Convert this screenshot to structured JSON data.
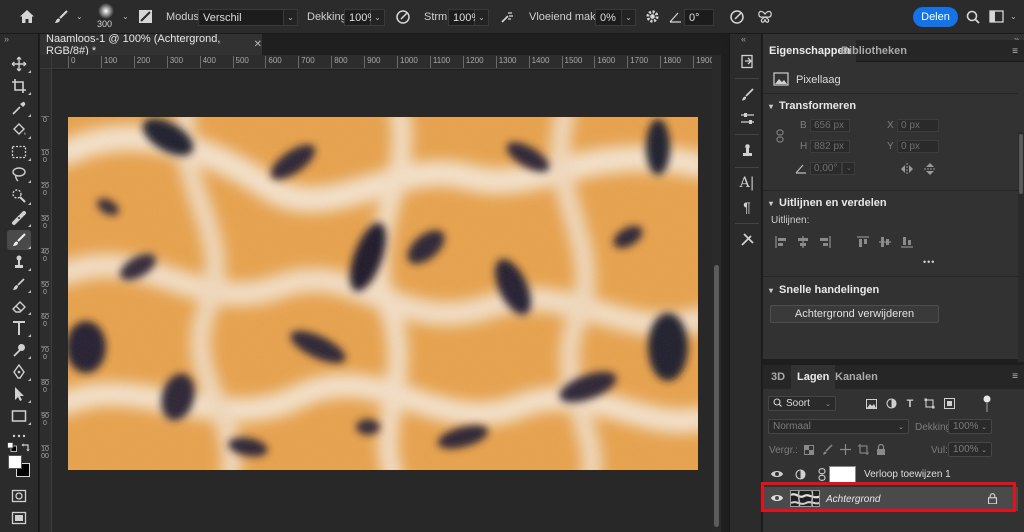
{
  "options_bar": {
    "brush_size": "300",
    "modus_label": "Modus:",
    "modus_value": "Verschil",
    "dekking_label": "Dekking:",
    "dekking_value": "100%",
    "strm_label": "Strm:",
    "strm_value": "100%",
    "vloeiend_label": "Vloeiend maken:",
    "vloeiend_value": "0%",
    "angle_value": "0°",
    "share_label": "Delen"
  },
  "document": {
    "tab_title": "Naamloos-1 @ 100% (Achtergrond, RGB/8#) *",
    "ruler_h": [
      "0",
      "100",
      "200",
      "300",
      "400",
      "500",
      "600",
      "700",
      "800",
      "900",
      "1000",
      "1100",
      "1200",
      "1300",
      "1400",
      "1500",
      "1600",
      "1700",
      "1800",
      "1900"
    ],
    "ruler_v": [
      "0",
      "100",
      "200",
      "300",
      "400",
      "500",
      "600",
      "700",
      "800",
      "900",
      "1000"
    ]
  },
  "properties": {
    "tabs": [
      "Eigenschappen",
      "Bibliotheken"
    ],
    "layer_kind": "Pixellaag",
    "transform": {
      "header": "Transformeren",
      "w_label": "B",
      "w_value": "656 px",
      "h_label": "H",
      "h_value": "882 px",
      "x_label": "X",
      "x_value": "0 px",
      "y_label": "Y",
      "y_value": "0 px",
      "angle_value": "0,00°"
    },
    "align": {
      "header": "Uitlijnen en verdelen",
      "sub_label": "Uitlijnen:",
      "more": "•••"
    },
    "quick": {
      "header": "Snelle handelingen",
      "button_label": "Achtergrond verwijderen"
    }
  },
  "layers": {
    "tabs": [
      "3D",
      "Lagen",
      "Kanalen"
    ],
    "filter_label": "Soort",
    "blend_mode": "Normaal",
    "opacity_label": "Dekking:",
    "opacity_value": "100%",
    "lock_label": "Vergr.:",
    "fill_label": "Vul:",
    "fill_value": "100%",
    "items": [
      {
        "name": "Verloop toewijzen 1"
      },
      {
        "name": "Achtergrond"
      }
    ]
  },
  "colors": {
    "accent": "#1473e6",
    "highlight": "#e3111b"
  }
}
